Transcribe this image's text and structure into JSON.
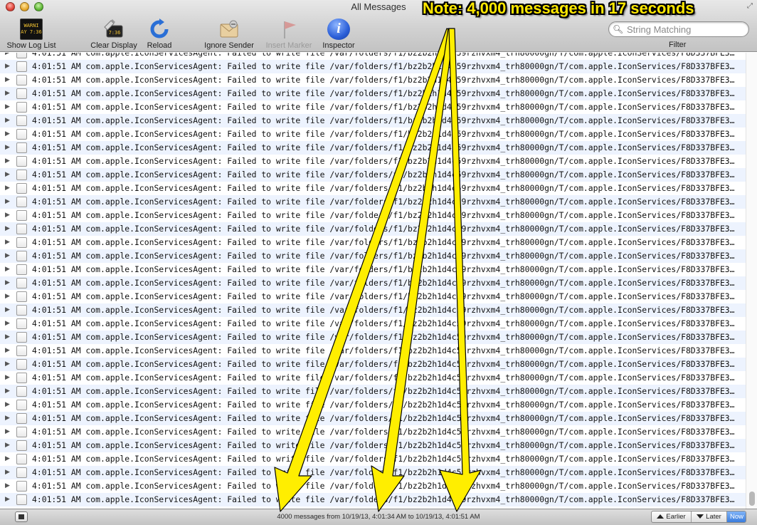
{
  "window": {
    "title": "All Messages"
  },
  "toolbar": {
    "show_log_list": "Show Log List",
    "clear_display": "Clear Display",
    "reload": "Reload",
    "ignore_sender": "Ignore Sender",
    "insert_marker": "Insert Marker",
    "inspector": "Inspector",
    "console_icon_text": [
      "WARNI",
      "AY 7:36"
    ],
    "clear_icon_text": "7:36"
  },
  "filter": {
    "placeholder": "String Matching",
    "value": "",
    "label": "Filter"
  },
  "log": {
    "row_count": 34,
    "rows": [
      "4:01:51 AM com.apple.IconServicesAgent: Failed to write file /var/folders/f1/bz2b2h1d4c59rzhvxm4_trh80000gn/T/com.apple.IconServices/F8D337BFE3DB921…",
      "4:01:51 AM com.apple.IconServicesAgent: Failed to write file /var/folders/f1/bz2b2h1d4c59rzhvxm4_trh80000gn/T/com.apple.IconServices/F8D337BFE3DB921…",
      "4:01:51 AM com.apple.IconServicesAgent: Failed to write file /var/folders/f1/bz2b2h1d4c59rzhvxm4_trh80000gn/T/com.apple.IconServices/F8D337BFE3DB921…",
      "4:01:51 AM com.apple.IconServicesAgent: Failed to write file /var/folders/f1/bz2b2h1d4c59rzhvxm4_trh80000gn/T/com.apple.IconServices/F8D337BFE3DB921…",
      "4:01:51 AM com.apple.IconServicesAgent: Failed to write file /var/folders/f1/bz2b2h1d4c59rzhvxm4_trh80000gn/T/com.apple.IconServices/F8D337BFE3DB921…",
      "4:01:51 AM com.apple.IconServicesAgent: Failed to write file /var/folders/f1/bz2b2h1d4c59rzhvxm4_trh80000gn/T/com.apple.IconServices/F8D337BFE3DB921…",
      "4:01:51 AM com.apple.IconServicesAgent: Failed to write file /var/folders/f1/bz2b2h1d4c59rzhvxm4_trh80000gn/T/com.apple.IconServices/F8D337BFE3DB921…",
      "4:01:51 AM com.apple.IconServicesAgent: Failed to write file /var/folders/f1/bz2b2h1d4c59rzhvxm4_trh80000gn/T/com.apple.IconServices/F8D337BFE3DB921…",
      "4:01:51 AM com.apple.IconServicesAgent: Failed to write file /var/folders/f1/bz2b2h1d4c59rzhvxm4_trh80000gn/T/com.apple.IconServices/F8D337BFE3DB921…",
      "4:01:51 AM com.apple.IconServicesAgent: Failed to write file /var/folders/f1/bz2b2h1d4c59rzhvxm4_trh80000gn/T/com.apple.IconServices/F8D337BFE3DB92…",
      "4:01:51 AM com.apple.IconServicesAgent: Failed to write file /var/folders/f1/bz2b2h1d4c59rzhvxm4_trh80000gn/T/com.apple.IconServices/F8D337BFE3DB921…",
      "4:01:51 AM com.apple.IconServicesAgent: Failed to write file /var/folders/f1/bz2b2h1d4c59rzhvxm4_trh80000gn/T/com.apple.IconServices/F8D337BFE3DB921…",
      "4:01:51 AM com.apple.IconServicesAgent: Failed to write file /var/folders/f1/bz2b2h1d4c59rzhvxm4_trh80000gn/T/com.apple.IconServices/F8D337BFE3DB921…",
      "4:01:51 AM com.apple.IconServicesAgent: Failed to write file /var/folders/f1/bz2b2h1d4c59rzhvxm4_trh80000gn/T/com.apple.IconServices/F8D337BFE3DB921…",
      "4:01:51 AM com.apple.IconServicesAgent: Failed to write file /var/folders/f1/bz2b2h1d4c59rzhvxm4_trh80000gn/T/com.apple.IconServices/F8D337BFE3DB921…",
      "4:01:51 AM com.apple.IconServicesAgent: Failed to write file /var/folders/f1/bz2b2h1d4c59rzhvxm4_trh80000gn/T/com.apple.IconServices/F8D337BFE3DB921…",
      "4:01:51 AM com.apple.IconServicesAgent: Failed to write file /var/folders/f1/bz2b2h1d4c59rzhvxm4_trh80000gn/T/com.apple.IconServices/F8D337BFE3DB921…",
      "4:01:51 AM com.apple.IconServicesAgent: Failed to write file /var/folders/f1/bz2b2h1d4c59rzhvxm4_trh80000gn/T/com.apple.IconServices/F8D337BFE3DB921…",
      "4:01:51 AM com.apple.IconServicesAgent: Failed to write file /var/folders/f1/bz2b2h1d4c59rzhvxm4_trh80000gn/T/com.apple.IconServices/F8D337BFE3DB921…",
      "4:01:51 AM com.apple.IconServicesAgent: Failed to write file /var/folders/f1/bz2b2h1d4c59rzhvxm4_trh80000gn/T/com.apple.IconServices/F8D337BFE3DB921…",
      "4:01:51 AM com.apple.IconServicesAgent: Failed to write file /var/folders/f1/bz2b2h1d4c59rzhvxm4_trh80000gn/T/com.apple.IconServices/F8D337BFE3DB921…",
      "4:01:51 AM com.apple.IconServicesAgent: Failed to write file /var/folders/f1/bz2b2h1d4c59rzhvxm4_trh80000gn/T/com.apple.IconServices/F8D337BFE3DB921…",
      "4:01:51 AM com.apple.IconServicesAgent: Failed to write file /var/folders/f1/bz2b2h1d4c59rzhvxm4_trh80000gn/T/com.apple.IconServices/F8D337BFE3DB921…",
      "4:01:51 AM com.apple.IconServicesAgent: Failed to write file /var/folders/f1/bz2b2h1d4c59rzhvxm4_trh80000gn/T/com.apple.IconServices/F8D337BFE3DB921…",
      "4:01:51 AM com.apple.IconServicesAgent: Failed to write file /var/folders/f1/bz2b2h1d4c59rzhvxm4_trh80000gn/T/com.apple.IconServices/F8D337BFE3DB921…",
      "4:01:51 AM com.apple.IconServicesAgent: Failed to write file /var/folders/f1/bz2b2h1d4c59rzhvxm4_trh80000gn/T/com.apple.IconServices/F8D337BFE3DB921…",
      "4:01:51 AM com.apple.IconServicesAgent: Failed to write file /var/folders/f1/bz2b2h1d4c59rzhvxm4_trh80000gn/T/com.apple.IconServices/F8D337BFE3DB921…",
      "4:01:51 AM com.apple.IconServicesAgent: Failed to write file /var/folders/f1/bz2b2h1d4c59rzhvxm4_trh80000gn/T/com.apple.IconServices/F8D337BFE3DB921…",
      "4:01:51 AM com.apple.IconServicesAgent: Failed to write file /var/folders/f1/bz2b2h1d4c59rzhvxm4_trh80000gn/T/com.apple.IconServices/F8D337BFE3DB921…",
      "4:01:51 AM com.apple.IconServicesAgent: Failed to write file /var/folders/f1/bz2b2h1d4c59rzhvxm4_trh80000gn/T/com.apple.IconServices/F8D337BFE3DB921…",
      "4:01:51 AM com.apple.IconServicesAgent: Failed to write file /var/folders/f1/bz2b2h1d4c59rzhvxm4_trh80000gn/T/com.apple.IconServices/F8D337BFE3DB921…",
      "4:01:51 AM com.apple.IconServicesAgent: Failed to write file /var/folders/f1/bz2b2h1d4c59rzhvxm4_trh80000gn/T/com.apple.IconServices/F8D337BFE3DB921…",
      "4:01:51 AM com.apple.IconServicesAgent: Failed to write file /var/folders/f1/bz2b2h1d4c59rzhvxm4_trh80000gn/T/com.apple.IconServices/F8D337BFE3DB921…",
      "4:01:51 AM com.apple.IconServicesAgent: Failed to write file /var/folders/f1/bz2b2h1d4c59rzhvxm4_trh80000gn/T/com.apple.IconServices/F8D337BFE3DB921…"
    ]
  },
  "status": {
    "summary": "4000 messages from 10/19/13, 4:01:34 AM to 10/19/13, 4:01:51 AM",
    "earlier": "Earlier",
    "later": "Later",
    "now": "Now"
  },
  "annotation": {
    "note": "Note: 4,000 messages in 17 seconds",
    "color": "#ffe800"
  },
  "icons": {
    "show_log_list": "console-icon",
    "clear_display": "clear-display-icon",
    "reload": "reload-icon",
    "ignore_sender": "ignore-sender-icon",
    "insert_marker": "flag-icon",
    "inspector": "info-icon",
    "search": "magnifier-icon"
  },
  "colors": {
    "row_alt": "#edf3fe",
    "now_button": "#3b7ddd"
  }
}
